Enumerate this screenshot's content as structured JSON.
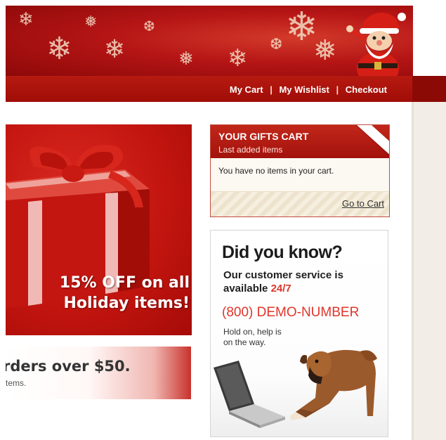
{
  "nav": {
    "my_cart": "My Cart",
    "sep1": "|",
    "my_wishlist": "My Wishlist",
    "sep2": "|",
    "checkout": "Checkout"
  },
  "promo": {
    "line1": "15% OFF on all",
    "line2": "Holiday items!"
  },
  "shipping_strip": {
    "headline": "rders over $50.",
    "subline": "tems."
  },
  "cart": {
    "title": "YOUR GIFTS CART",
    "subtitle": "Last added items",
    "empty_message": "You have no items in your cart.",
    "go_to_cart": "Go to Cart"
  },
  "did_you_know": {
    "title": "Did you know?",
    "line1": "Our customer service is",
    "line2_prefix": "available",
    "line2_highlight": "24/7",
    "phone": "(800) DEMO-NUMBER",
    "note_line1": "Hold on, help is",
    "note_line2": "on the way."
  },
  "colors": {
    "brand_red": "#b51515",
    "accent_red": "#e0352b",
    "nav_text": "#ffffff"
  },
  "icons": [
    "snowflake-icon",
    "santa-illustration",
    "gift-box-illustration",
    "dog-illustration",
    "laptop-illustration"
  ]
}
